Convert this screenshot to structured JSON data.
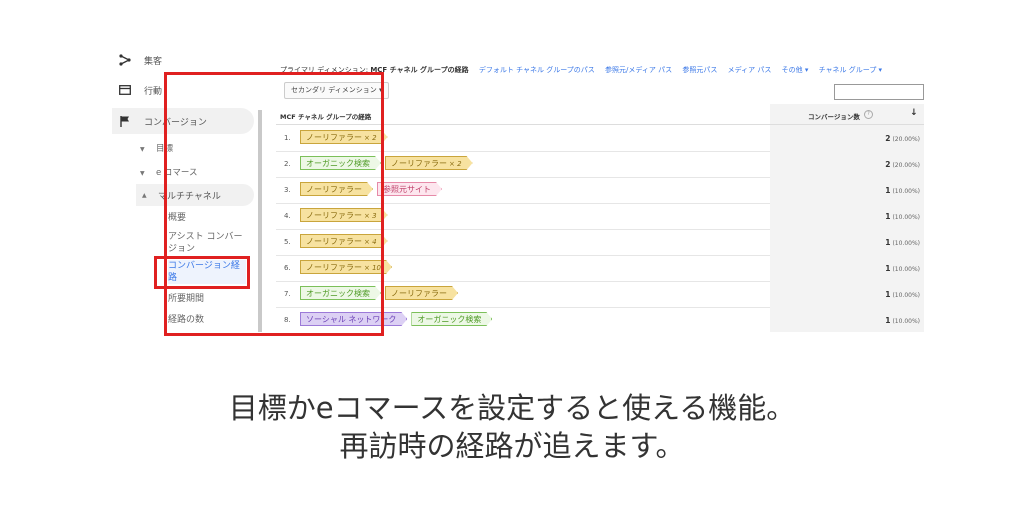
{
  "sidebar": {
    "acquisition": "集客",
    "behavior": "行動",
    "conversions": "コンバージョン",
    "goals": "目標",
    "ecommerce": "e コマース",
    "multichannel": "マルチチャネル",
    "leaves": [
      "概要",
      "アシスト コンバージョン",
      "コンバージョン経路",
      "所要期間",
      "経路の数"
    ]
  },
  "dimensions": {
    "primary_label": "プライマリ ディメンション:",
    "current": "MCF チャネル グループの経路",
    "options": [
      "デフォルト チャネル グループのパス",
      "参照元/メディア パス",
      "参照元パス",
      "メディア パス",
      "その他 ▾",
      "チャネル グループ ▾"
    ],
    "secondary_button": "セカンダリ ディメンション ▾"
  },
  "table": {
    "col_path": "MCF チャネル グループの経路",
    "col_metric": "コンバージョン数",
    "info_icon": "?",
    "sort_arrow": "↓",
    "rows": [
      {
        "num": "1.",
        "tags": [
          {
            "text": "ノーリファラー",
            "count": "× 2",
            "type": "direct"
          }
        ],
        "value": "2",
        "pct": "(20.00%)"
      },
      {
        "num": "2.",
        "tags": [
          {
            "text": "オーガニック検索",
            "count": "",
            "type": "organic"
          },
          {
            "text": "ノーリファラー",
            "count": "× 2",
            "type": "direct"
          }
        ],
        "value": "2",
        "pct": "(20.00%)"
      },
      {
        "num": "3.",
        "tags": [
          {
            "text": "ノーリファラー",
            "count": "",
            "type": "direct"
          },
          {
            "text": "参照元サイト",
            "count": "",
            "type": "referral"
          }
        ],
        "value": "1",
        "pct": "(10.00%)"
      },
      {
        "num": "4.",
        "tags": [
          {
            "text": "ノーリファラー",
            "count": "× 3",
            "type": "direct"
          }
        ],
        "value": "1",
        "pct": "(10.00%)"
      },
      {
        "num": "5.",
        "tags": [
          {
            "text": "ノーリファラー",
            "count": "× 4",
            "type": "direct"
          }
        ],
        "value": "1",
        "pct": "(10.00%)"
      },
      {
        "num": "6.",
        "tags": [
          {
            "text": "ノーリファラー",
            "count": "× 10",
            "type": "direct"
          }
        ],
        "value": "1",
        "pct": "(10.00%)"
      },
      {
        "num": "7.",
        "tags": [
          {
            "text": "オーガニック検索",
            "count": "",
            "type": "organic"
          },
          {
            "text": "ノーリファラー",
            "count": "",
            "type": "direct"
          }
        ],
        "value": "1",
        "pct": "(10.00%)"
      },
      {
        "num": "8.",
        "tags": [
          {
            "text": "ソーシャル ネットワーク",
            "count": "",
            "type": "social"
          },
          {
            "text": "オーガニック検索",
            "count": "",
            "type": "organic"
          }
        ],
        "value": "1",
        "pct": "(10.00%)"
      }
    ]
  },
  "caption": {
    "line1": "目標かeコマースを設定すると使える機能。",
    "line2": "再訪時の経路が追えます。"
  },
  "colors": {
    "highlight": "#e02020",
    "link": "#3b78e7"
  }
}
